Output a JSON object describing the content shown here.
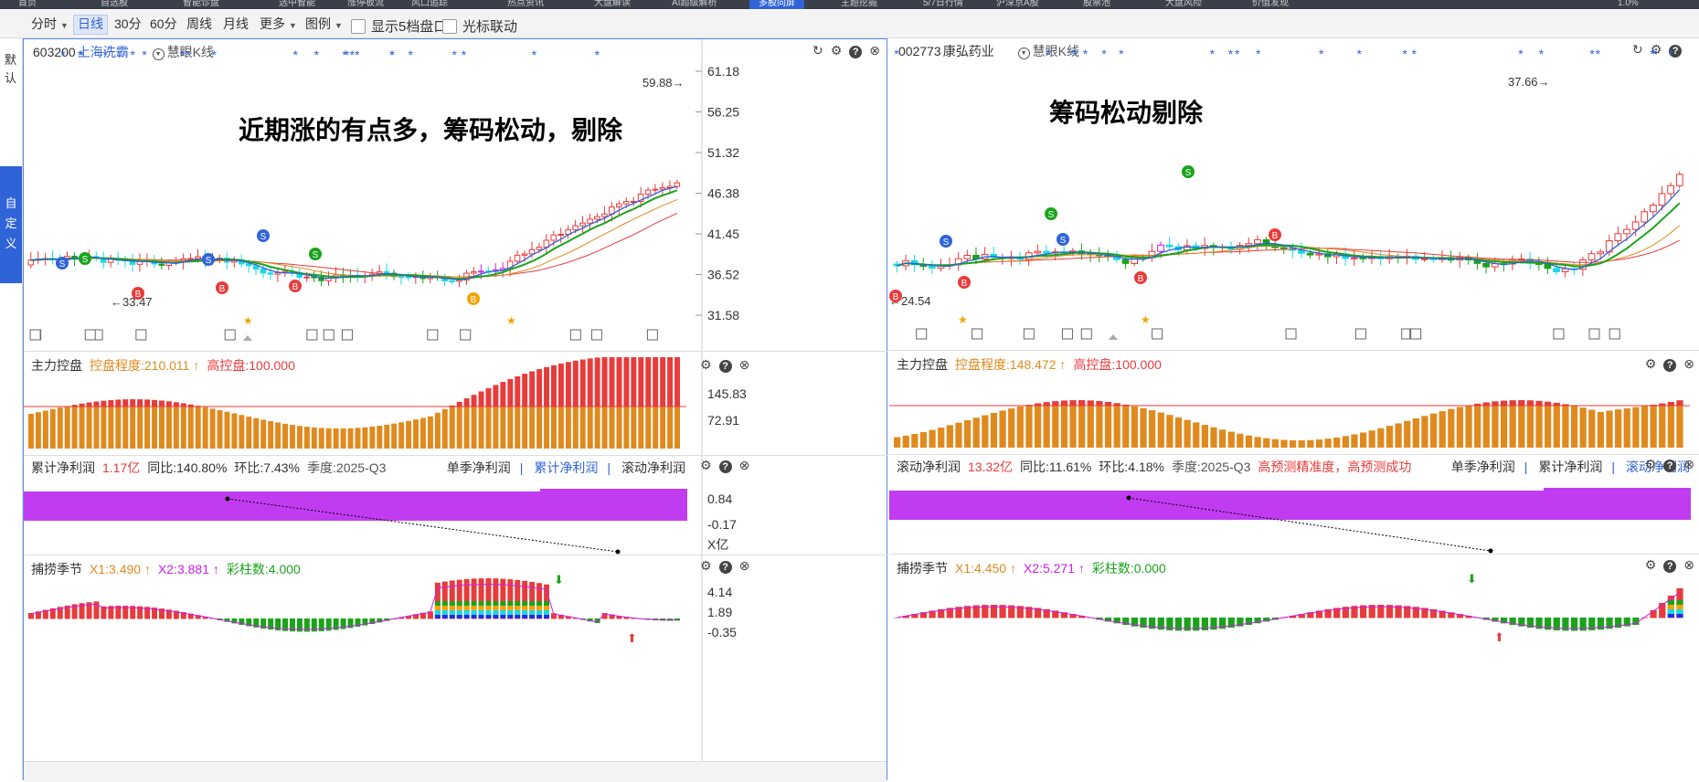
{
  "top_nav": {
    "tabs": [
      "首页",
      "自选股",
      "智能诊盘",
      "选中智能",
      "涨停板流",
      "风口追踪",
      "热点资讯",
      "大盘解读",
      "AI超级解析",
      "多股同屏",
      "主题挖掘",
      "5/7日行情",
      "沪深京A股",
      "股票池",
      "大盘风险",
      "价值发现"
    ],
    "active_index": 9,
    "zoom": "1.0%"
  },
  "toolbar": {
    "items": [
      "分时",
      "日线",
      "30分",
      "60分",
      "周线",
      "月线",
      "更多",
      "图例"
    ],
    "active": "日线",
    "checkboxes": [
      "显示5档盘口",
      "光标联动"
    ]
  },
  "left_sidebar": {
    "default_label": "默认",
    "custom_label": "自定义"
  },
  "colors": {
    "up": "#e83b3b",
    "down": "#1aa31a",
    "accent": "#2f63d8",
    "orange": "#e08a1e",
    "magenta": "#cc1fe6",
    "cyan": "#18d9e6",
    "purple_bar": "#c13bf0"
  },
  "panels": [
    {
      "code": "603200",
      "name": "上海洗霸",
      "kline_label": "慧眼K线",
      "note": "近期涨的有点多，筹码松动，剔除",
      "price_axis": [
        "61.18",
        "56.25",
        "51.32",
        "46.38",
        "41.45",
        "36.52",
        "31.58"
      ],
      "high_label": "59.88",
      "low_label": "33.47",
      "control": {
        "title": "主力控盘",
        "degree": "控盘程度:210.011",
        "high": "高控盘:100.000",
        "axis": [
          "145.83",
          "72.91"
        ]
      },
      "profit": {
        "title": "累计净利润",
        "value": "1.17亿",
        "yoy": "同比:140.80%",
        "qoq": "环比:7.43%",
        "quarter": "季度:2025-Q3",
        "tabs": [
          "单季净利润",
          "累计净利润",
          "滚动净利润"
        ],
        "selected_tab": "累计净利润",
        "axis": [
          "0.84",
          "-0.17"
        ],
        "unit": "X亿"
      },
      "season": {
        "title": "捕捞季节",
        "x1": "X1:3.490",
        "x2": "X2:3.881",
        "bars": "彩柱数:4.000",
        "axis": [
          "4.14",
          "1.89",
          "-0.35"
        ]
      }
    },
    {
      "code": "002773",
      "name": "康弘药业",
      "kline_label": "慧眼K线",
      "note": "筹码松动剔除",
      "price_axis": [],
      "high_label": "37.66",
      "low_label": "24.54",
      "control": {
        "title": "主力控盘",
        "degree": "控盘程度:148.472",
        "high": "高控盘:100.000",
        "axis": []
      },
      "profit": {
        "title": "滚动净利润",
        "value": "13.32亿",
        "yoy": "同比:11.61%",
        "qoq": "环比:4.18%",
        "quarter": "季度:2025-Q3",
        "extra": "高预测精准度，高预测成功",
        "tabs": [
          "单季净利润",
          "累计净利润",
          "滚动净利润"
        ],
        "selected_tab": "滚动净利润",
        "axis": [],
        "unit": ""
      },
      "season": {
        "title": "捕捞季节",
        "x1": "X1:4.450",
        "x2": "X2:5.271",
        "bars": "彩柱数:0.000",
        "axis": []
      }
    }
  ]
}
